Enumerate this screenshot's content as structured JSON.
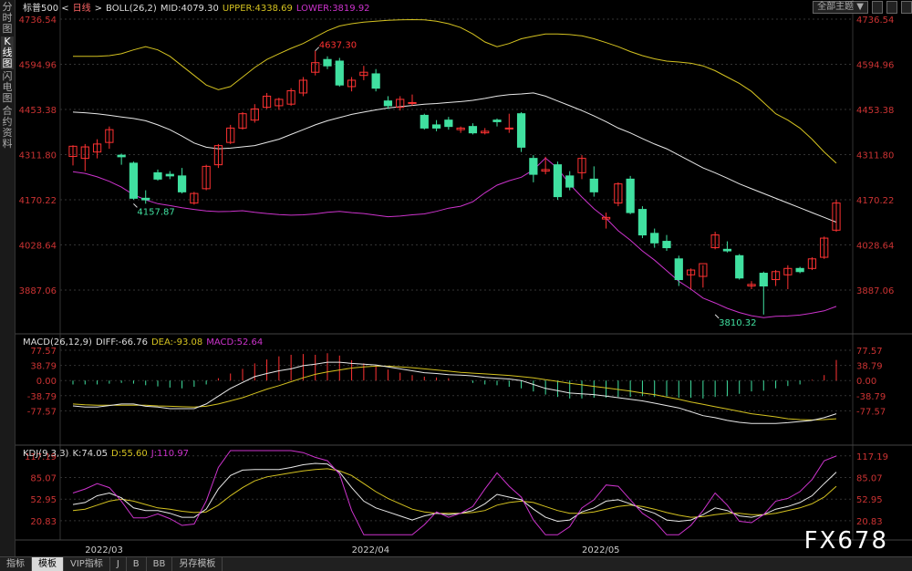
{
  "sidebar_tabs": [
    "分时图",
    "K线图",
    "闪电图",
    "合约资料"
  ],
  "sidebar_active": 1,
  "bottom_tabs": [
    "指标",
    "模板",
    "VIP指标",
    "J",
    "B",
    "BB",
    "另存模板"
  ],
  "bottom_active": 1,
  "top_right": {
    "select_label": "全部主题",
    "select_arrow": "▼"
  },
  "watermark": "FX678",
  "colors": {
    "up": "#ff3232",
    "down": "#40e0a0",
    "mid": "#e8e8e8",
    "upper": "#d4c220",
    "lower": "#cc33cc",
    "axis": "#cc3333",
    "grid": "#333333",
    "dea": "#d4c220",
    "macd_up": "#ff3232",
    "macd_down": "#40e0a0",
    "k": "#e8e8e8",
    "d": "#d4c220",
    "j": "#cc33cc"
  },
  "chart_data": [
    {
      "type": "candlestick",
      "name": "标普500",
      "period": "日线",
      "legend": {
        "prefix": "标普500 <",
        "period": "日线",
        "suffix": ">",
        "boll": "BOLL(26,2)",
        "mid": "MID:4079.30",
        "upper": "UPPER:4338.69",
        "lower": "LOWER:3819.92"
      },
      "y_ticks": [
        "4736.54",
        "4594.96",
        "4453.38",
        "4311.80",
        "4170.22",
        "4028.64",
        "3887.06"
      ],
      "y_tick_values": [
        4736.54,
        4594.96,
        4453.38,
        4311.8,
        4170.22,
        4028.64,
        3887.06
      ],
      "ylim": [
        3790,
        4745
      ],
      "annotations": [
        {
          "label": "4637.30",
          "index": 20,
          "value": 4637.3,
          "side": "high"
        },
        {
          "label": "4157.87",
          "index": 5,
          "value": 4157.87,
          "side": "low"
        },
        {
          "label": "3810.32",
          "index": 53,
          "value": 3810.32,
          "side": "low"
        }
      ],
      "x_labels": [
        {
          "label": "2022/03",
          "index": 1
        },
        {
          "label": "2022/04",
          "index": 23
        },
        {
          "label": "2022/05",
          "index": 42
        }
      ],
      "ohlc": [
        [
          4306,
          4338,
          4278,
          4341
        ],
        [
          4300,
          4336,
          4260,
          4345
        ],
        [
          4320,
          4345,
          4300,
          4360
        ],
        [
          4350,
          4390,
          4330,
          4400
        ],
        [
          4310,
          4305,
          4280,
          4315
        ],
        [
          4285,
          4175,
          4170,
          4290
        ],
        [
          4175,
          4170,
          4157.87,
          4200
        ],
        [
          4255,
          4235,
          4230,
          4265
        ],
        [
          4250,
          4245,
          4235,
          4260
        ],
        [
          4245,
          4195,
          4190,
          4270
        ],
        [
          4160,
          4190,
          4155,
          4195
        ],
        [
          4205,
          4275,
          4200,
          4280
        ],
        [
          4280,
          4340,
          4270,
          4345
        ],
        [
          4350,
          4395,
          4345,
          4405
        ],
        [
          4395,
          4440,
          4390,
          4445
        ],
        [
          4420,
          4455,
          4412,
          4470
        ],
        [
          4460,
          4495,
          4455,
          4505
        ],
        [
          4465,
          4485,
          4452,
          4490
        ],
        [
          4470,
          4512,
          4465,
          4520
        ],
        [
          4505,
          4545,
          4495,
          4555
        ],
        [
          4570,
          4600,
          4560,
          4637.3
        ],
        [
          4610,
          4590,
          4580,
          4620
        ],
        [
          4605,
          4530,
          4525,
          4615
        ],
        [
          4525,
          4545,
          4510,
          4555
        ],
        [
          4560,
          4570,
          4545,
          4590
        ],
        [
          4565,
          4520,
          4510,
          4580
        ],
        [
          4480,
          4465,
          4455,
          4495
        ],
        [
          4460,
          4485,
          4450,
          4495
        ],
        [
          4475,
          4475,
          4465,
          4500
        ],
        [
          4435,
          4395,
          4390,
          4440
        ],
        [
          4405,
          4395,
          4385,
          4420
        ],
        [
          4420,
          4400,
          4390,
          4430
        ],
        [
          4390,
          4395,
          4380,
          4400
        ],
        [
          4400,
          4380,
          4375,
          4410
        ],
        [
          4380,
          4385,
          4375,
          4395
        ],
        [
          4420,
          4415,
          4400,
          4425
        ],
        [
          4395,
          4395,
          4380,
          4440
        ],
        [
          4440,
          4335,
          4320,
          4445
        ],
        [
          4300,
          4250,
          4225,
          4310
        ],
        [
          4260,
          4265,
          4250,
          4305
        ],
        [
          4280,
          4180,
          4170,
          4290
        ],
        [
          4245,
          4210,
          4200,
          4260
        ],
        [
          4255,
          4300,
          4235,
          4310
        ],
        [
          4235,
          4195,
          4180,
          4275
        ],
        [
          4110,
          4115,
          4080,
          4130
        ],
        [
          4160,
          4220,
          4150,
          4225
        ],
        [
          4235,
          4130,
          4125,
          4245
        ],
        [
          4140,
          4060,
          4050,
          4150
        ],
        [
          4065,
          4035,
          4020,
          4080
        ],
        [
          4040,
          4020,
          4010,
          4060
        ],
        [
          3985,
          3920,
          3900,
          3995
        ],
        [
          3935,
          3950,
          3890,
          3955
        ],
        [
          3930,
          3970,
          3895,
          3965
        ],
        [
          4020,
          4060,
          4015,
          4070
        ],
        [
          4015,
          4010,
          4005,
          4040
        ],
        [
          3995,
          3925,
          3920,
          4000
        ],
        [
          3900,
          3905,
          3890,
          3915
        ],
        [
          3940,
          3900,
          3810.32,
          3945
        ],
        [
          3920,
          3945,
          3900,
          3950
        ],
        [
          3935,
          3955,
          3890,
          3965
        ],
        [
          3955,
          3945,
          3940,
          3960
        ],
        [
          3955,
          3985,
          3950,
          3990
        ],
        [
          3990,
          4050,
          3985,
          4055
        ],
        [
          4075,
          4160,
          4070,
          4170
        ]
      ],
      "boll_mid": [
        4445,
        4443,
        4440,
        4435,
        4430,
        4425,
        4418,
        4405,
        4390,
        4370,
        4348,
        4335,
        4330,
        4332,
        4336,
        4340,
        4350,
        4360,
        4375,
        4390,
        4405,
        4418,
        4428,
        4438,
        4445,
        4452,
        4458,
        4462,
        4466,
        4470,
        4472,
        4475,
        4478,
        4482,
        4488,
        4495,
        4500,
        4502,
        4505,
        4495,
        4480,
        4465,
        4450,
        4433,
        4415,
        4395,
        4380,
        4362,
        4345,
        4330,
        4310,
        4290,
        4270,
        4255,
        4238,
        4220,
        4205,
        4190,
        4175,
        4160,
        4145,
        4130,
        4115,
        4100
      ],
      "boll_upper": [
        4620,
        4620,
        4620,
        4622,
        4628,
        4640,
        4650,
        4640,
        4620,
        4590,
        4560,
        4530,
        4515,
        4525,
        4555,
        4585,
        4610,
        4628,
        4645,
        4660,
        4680,
        4700,
        4715,
        4722,
        4727,
        4730,
        4733,
        4734,
        4735,
        4734,
        4730,
        4722,
        4710,
        4690,
        4665,
        4650,
        4660,
        4675,
        4683,
        4690,
        4690,
        4688,
        4684,
        4675,
        4663,
        4650,
        4635,
        4622,
        4612,
        4605,
        4602,
        4598,
        4590,
        4575,
        4555,
        4535,
        4510,
        4475,
        4440,
        4420,
        4395,
        4360,
        4320,
        4285
      ],
      "boll_lower": [
        4258,
        4253,
        4242,
        4228,
        4210,
        4186,
        4170,
        4158,
        4152,
        4145,
        4140,
        4135,
        4133,
        4134,
        4136,
        4131,
        4127,
        4124,
        4122,
        4123,
        4126,
        4131,
        4134,
        4130,
        4127,
        4122,
        4117,
        4119,
        4123,
        4126,
        4134,
        4144,
        4150,
        4164,
        4192,
        4216,
        4230,
        4241,
        4264,
        4301,
        4269,
        4219,
        4179,
        4142,
        4112,
        4073,
        4044,
        4010,
        3981,
        3948,
        3915,
        3890,
        3862,
        3847,
        3830,
        3817,
        3807,
        3801,
        3805,
        3806,
        3809,
        3815,
        3822,
        3836
      ]
    },
    {
      "type": "bar+line",
      "name": "MACD",
      "legend": {
        "params": "MACD(26,12,9)",
        "diff": "DIFF:-66.76",
        "dea": "DEA:-93.08",
        "macd": "MACD:52.64"
      },
      "y_ticks": [
        "77.57",
        "38.79",
        "0.00",
        "-38.79",
        "-77.57"
      ],
      "y_tick_values": [
        77.57,
        38.79,
        0,
        -38.79,
        -77.57
      ],
      "ylim": [
        -116.36,
        77.57
      ],
      "diff": [
        -65,
        -68,
        -68,
        -64,
        -60,
        -60,
        -66,
        -68,
        -72,
        -72,
        -72,
        -60,
        -40,
        -20,
        -5,
        10,
        18,
        25,
        30,
        38,
        42,
        47,
        47,
        44,
        42,
        40,
        35,
        30,
        25,
        20,
        18,
        15,
        14,
        12,
        8,
        6,
        4,
        0,
        -10,
        -20,
        -26,
        -32,
        -34,
        -36,
        -40,
        -44,
        -48,
        -52,
        -58,
        -64,
        -70,
        -80,
        -90,
        -95,
        -102,
        -107,
        -110,
        -110,
        -110,
        -108,
        -105,
        -102,
        -95,
        -85
      ],
      "dea": [
        -60,
        -62,
        -63,
        -63,
        -63,
        -63,
        -63,
        -65,
        -66,
        -67,
        -68,
        -66,
        -60,
        -52,
        -44,
        -33,
        -22,
        -13,
        -3,
        7,
        16,
        22,
        27,
        32,
        35,
        37,
        37,
        35,
        33,
        30,
        27,
        24,
        21,
        19,
        17,
        15,
        13,
        10,
        7,
        2,
        -2,
        -7,
        -11,
        -15,
        -19,
        -23,
        -27,
        -32,
        -36,
        -42,
        -48,
        -55,
        -61,
        -67,
        -73,
        -79,
        -85,
        -89,
        -93,
        -98,
        -100,
        -101,
        -100,
        -98
      ],
      "macd": [
        -10,
        -10,
        -10,
        -8,
        -6,
        -8,
        -12,
        -15,
        -18,
        -20,
        -16,
        -10,
        6,
        18,
        30,
        44,
        54,
        62,
        66,
        68,
        66,
        70,
        64,
        52,
        44,
        38,
        28,
        20,
        14,
        10,
        8,
        6,
        0,
        -6,
        -10,
        -12,
        -16,
        -20,
        -28,
        -36,
        -42,
        -46,
        -46,
        -44,
        -44,
        -42,
        -42,
        -40,
        -42,
        -40,
        -44,
        -44,
        -46,
        -42,
        -40,
        -34,
        -28,
        -26,
        -20,
        -14,
        -10,
        2,
        14,
        52.64
      ]
    },
    {
      "type": "line",
      "name": "KDJ",
      "legend": {
        "params": "KDJ(9,3,3)",
        "k": "K:74.05",
        "d": "D:55.60",
        "j": "J:110.97"
      },
      "y_ticks": [
        "117.19",
        "85.07",
        "52.95",
        "20.83"
      ],
      "y_tick_values": [
        117.19,
        85.07,
        52.95,
        20.83
      ],
      "ylim": [
        -5,
        125
      ],
      "k": [
        45,
        48,
        58,
        62,
        55,
        40,
        36,
        36,
        32,
        26,
        26,
        38,
        68,
        88,
        96,
        97,
        97,
        97,
        100,
        104,
        106,
        105,
        93,
        70,
        50,
        40,
        34,
        28,
        22,
        28,
        32,
        30,
        32,
        36,
        46,
        60,
        56,
        52,
        38,
        26,
        20,
        22,
        34,
        40,
        50,
        52,
        46,
        38,
        32,
        22,
        20,
        22,
        30,
        40,
        36,
        28,
        26,
        30,
        38,
        42,
        48,
        58,
        76,
        93
      ],
      "d": [
        36,
        38,
        44,
        50,
        53,
        50,
        45,
        40,
        38,
        35,
        33,
        34,
        44,
        58,
        70,
        80,
        86,
        89,
        92,
        95,
        97,
        98,
        95,
        88,
        76,
        64,
        54,
        46,
        38,
        34,
        32,
        32,
        32,
        33,
        36,
        44,
        48,
        50,
        48,
        42,
        36,
        32,
        32,
        34,
        38,
        42,
        44,
        42,
        38,
        33,
        29,
        26,
        27,
        30,
        32,
        32,
        30,
        30,
        32,
        36,
        40,
        46,
        56,
        72
      ],
      "j": [
        62,
        68,
        76,
        70,
        50,
        25,
        25,
        31,
        24,
        14,
        16,
        50,
        100,
        125,
        125,
        125,
        125,
        125,
        125,
        122,
        115,
        110,
        90,
        36,
        0,
        0,
        0,
        0,
        0,
        15,
        34,
        26,
        32,
        42,
        68,
        92,
        72,
        56,
        22,
        0,
        0,
        12,
        40,
        52,
        74,
        72,
        52,
        32,
        20,
        0,
        0,
        14,
        36,
        62,
        44,
        20,
        18,
        30,
        50,
        54,
        64,
        82,
        110,
        117
      ]
    }
  ]
}
